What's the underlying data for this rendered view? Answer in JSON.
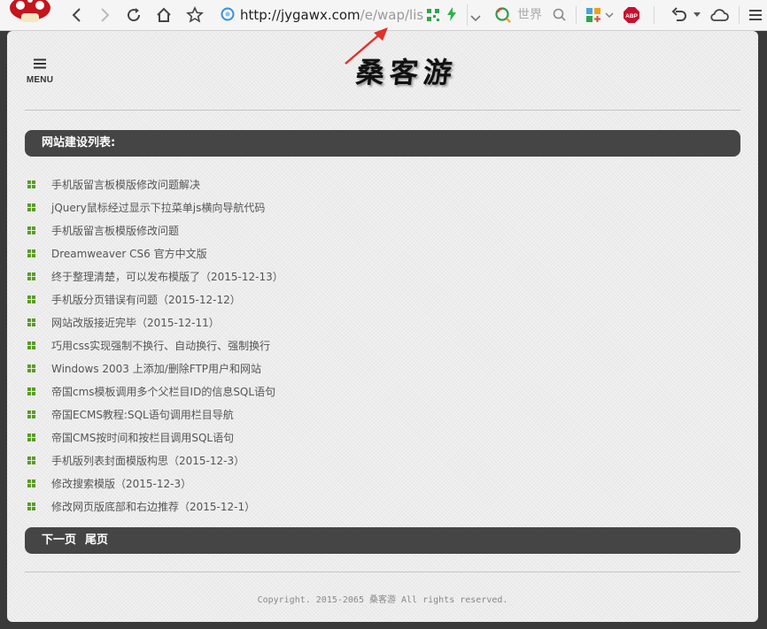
{
  "browser": {
    "url_host": "http://jygawx.com",
    "url_path": "/e/wap/lis",
    "search_placeholder": "世界",
    "abp_label": "ABP"
  },
  "header": {
    "menu_label": "MENU",
    "logo_text": "桑客游"
  },
  "list": {
    "title": "网站建设列表:",
    "items": [
      "手机版留言板模版修改问题解决",
      "jQuery鼠标经过显示下拉菜单js横向导航代码",
      "手机版留言板模版修改问题",
      "Dreamweaver CS6 官方中文版",
      "终于整理清楚，可以发布模版了（2015-12-13）",
      "手机版分页错误有问题（2015-12-12）",
      "网站改版接近完毕（2015-12-11）",
      "巧用css实现强制不换行、自动换行、强制换行",
      "Windows 2003 上添加/删除FTP用户和网站",
      "帝国cms模板调用多个父栏目ID的信息SQL语句",
      "帝国ECMS教程:SQL语句调用栏目导航",
      "帝国CMS按时间和按栏目调用SQL语句",
      "手机版列表封面模版构思（2015-12-3）",
      "修改搜索模版（2015-12-3）",
      "修改网页版底部和右边推荐（2015-12-1）"
    ]
  },
  "pager": {
    "next_label": "下一页",
    "last_label": "尾页"
  },
  "footer": {
    "copyright": "Copyright. 2015-2065 桑客游 All rights reserved."
  },
  "colors": {
    "bar": "#454545",
    "bullet": "#5a9a2a",
    "arrow": "#e0302a",
    "abp": "#c8102e"
  }
}
